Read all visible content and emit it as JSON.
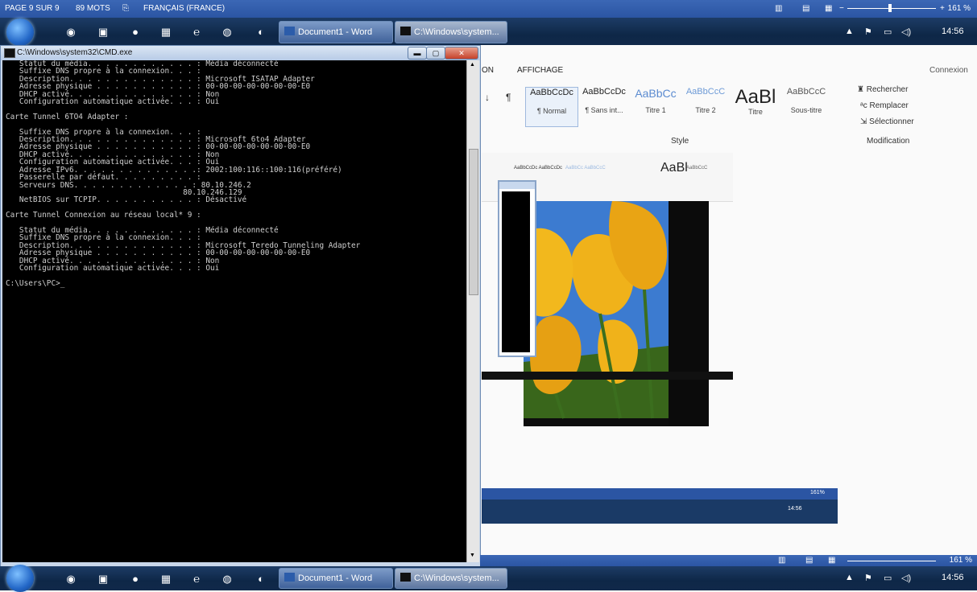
{
  "status_bar": {
    "page": "PAGE 9 SUR 9",
    "words": "89 MOTS",
    "language": "FRANÇAIS (FRANCE)",
    "zoom": "161 %"
  },
  "taskbar": {
    "word_button": "Document1 - Word",
    "cmd_button": "C:\\Windows\\system...",
    "time": "14:56"
  },
  "cmd": {
    "title": "C:\\Windows\\system32\\CMD.exe",
    "lines": [
      "   Statut du média. . . . . . . . . . . . : Média déconnecté",
      "   Suffixe DNS propre à la connexion. . . :",
      "   Description. . . . . . . . . . . . . . : Microsoft ISATAP Adapter",
      "   Adresse physique . . . . . . . . . . . : 00-00-00-00-00-00-00-E0",
      "   DHCP activé. . . . . . . . . . . . . . : Non",
      "   Configuration automatique activée. . . : Oui",
      "",
      "Carte Tunnel 6TO4 Adapter :",
      "",
      "   Suffixe DNS propre à la connexion. . . :",
      "   Description. . . . . . . . . . . . . . : Microsoft 6to4 Adapter",
      "   Adresse physique . . . . . . . . . . . : 00-00-00-00-00-00-00-E0",
      "   DHCP activé. . . . . . . . . . . . . . : Non",
      "   Configuration automatique activée. . . : Oui",
      "   Adresse IPv6. . . . . . . . . . . . . .: 2002:100:116::100:116(préféré)",
      "   Passerelle par défaut. . . . . . . . . :",
      "   Serveurs DNS. . . . . . . . . . . . . : 80.10.246.2",
      "                                       80.10.246.129",
      "   NetBIOS sur TCPIP. . . . . . . . . . . : Désactivé",
      "",
      "Carte Tunnel Connexion au réseau local* 9 :",
      "",
      "   Statut du média. . . . . . . . . . . . : Média déconnecté",
      "   Suffixe DNS propre à la connexion. . . :",
      "   Description. . . . . . . . . . . . . . : Microsoft Teredo Tunneling Adapter",
      "   Adresse physique . . . . . . . . . . . : 00-00-00-00-00-00-00-E0",
      "   DHCP activé. . . . . . . . . . . . . . : Non",
      "   Configuration automatique activée. . . : Oui",
      "",
      "C:\\Users\\PC>_"
    ]
  },
  "word": {
    "tab_on": "ON",
    "tab_affichage": "AFFICHAGE",
    "connexion": "Connexion",
    "styles": [
      {
        "sample": "AaBbCcDc",
        "label": "¶ Normal"
      },
      {
        "sample": "AaBbCcDc",
        "label": "¶ Sans int..."
      },
      {
        "sample": "AaBbCc",
        "label": "Titre 1"
      },
      {
        "sample": "AaBbCcC",
        "label": "Titre 2"
      },
      {
        "sample": "AaBl",
        "label": "Titre"
      },
      {
        "sample": "AaBbCcC",
        "label": "Sous-titre"
      }
    ],
    "group_style": "Style",
    "group_modification": "Modification",
    "rechercher": "Rechercher",
    "remplacer": "Remplacer",
    "selectionner": "Sélectionner",
    "nested_zoom": "161%",
    "nested_time": "14:56"
  },
  "colors": {
    "statusbar_blue": "#2b55a3",
    "taskbar_dark": "#0e2747",
    "console_bg": "#000000",
    "console_text": "#cfcfcf",
    "tulip_yellow": "#f0b21a"
  }
}
